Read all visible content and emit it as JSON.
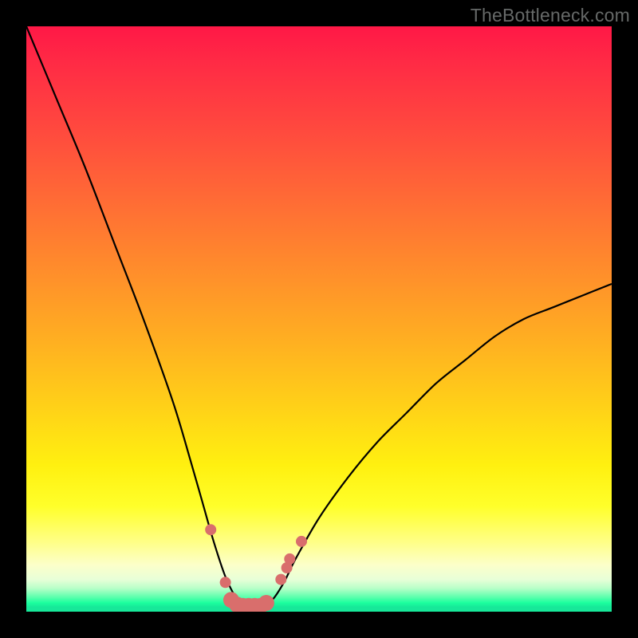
{
  "watermark": "TheBottleneck.com",
  "chart_data": {
    "type": "line",
    "title": "",
    "xlabel": "",
    "ylabel": "",
    "ylim": [
      0,
      100
    ],
    "xlim": [
      0,
      100
    ],
    "series": [
      {
        "name": "bottleneck-curve",
        "x": [
          0,
          5,
          10,
          15,
          20,
          25,
          28,
          30,
          32,
          34,
          36,
          37,
          38,
          40,
          42,
          44,
          46,
          50,
          55,
          60,
          65,
          70,
          75,
          80,
          85,
          90,
          95,
          100
        ],
        "values": [
          100,
          88,
          76,
          63,
          50,
          36,
          26,
          19,
          12,
          6,
          2,
          1,
          1,
          1,
          2,
          5,
          9,
          16,
          23,
          29,
          34,
          39,
          43,
          47,
          50,
          52,
          54,
          56
        ]
      }
    ],
    "markers": {
      "name": "data-points",
      "color": "#d96e6c",
      "radius_small": 7,
      "radius_large": 10,
      "points_xy": [
        [
          31.5,
          14
        ],
        [
          34.0,
          5
        ],
        [
          35.0,
          2
        ],
        [
          36.0,
          1.2
        ],
        [
          37.0,
          1
        ],
        [
          38.0,
          1
        ],
        [
          39.0,
          1
        ],
        [
          40.0,
          1
        ],
        [
          41.0,
          1.5
        ],
        [
          43.5,
          5.5
        ],
        [
          44.5,
          7.5
        ],
        [
          45.0,
          9
        ],
        [
          47.0,
          12
        ]
      ]
    },
    "gradient_stops": [
      {
        "pos": 0.0,
        "color": "#ff1846"
      },
      {
        "pos": 0.3,
        "color": "#ff6c35"
      },
      {
        "pos": 0.65,
        "color": "#ffd118"
      },
      {
        "pos": 0.88,
        "color": "#ffff85"
      },
      {
        "pos": 0.98,
        "color": "#1bff9e"
      }
    ]
  }
}
